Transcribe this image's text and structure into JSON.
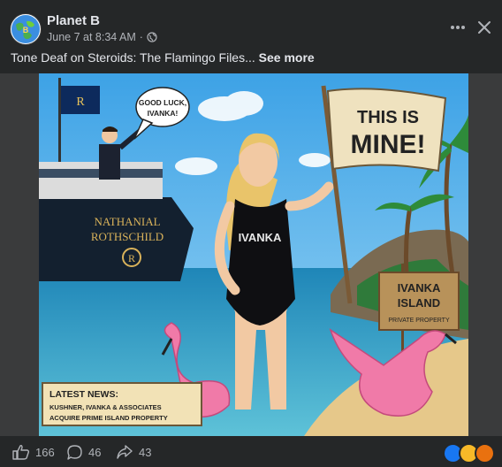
{
  "post": {
    "page_name": "Planet B",
    "timestamp": "June 7 at 8:34 AM",
    "separator": "·",
    "caption": "Tone Deaf on Steroids: The Flamingo Files...",
    "see_more": "See more"
  },
  "image": {
    "speech_bubble_line1": "GOOD LUCK,",
    "speech_bubble_line2": "IVANKA!",
    "flag_text": "R",
    "yacht_name_line1": "NATHANIAL",
    "yacht_name_line2": "ROTHSCHILD",
    "yacht_emblem": "R",
    "swimsuit_text": "IVANKA",
    "banner_line1": "THIS IS",
    "banner_line2": "MINE!",
    "sign_line1": "IVANKA",
    "sign_line2": "ISLAND",
    "sign_line3": "PRIVATE PROPERTY",
    "news_title": "LATEST NEWS:",
    "news_line1": "KUSHNER, IVANKA & ASSOCIATES",
    "news_line2": "ACQUIRE PRIME ISLAND PROPERTY"
  },
  "actions": {
    "likes": "166",
    "comments": "46",
    "shares": "43"
  },
  "reactions": [
    "like",
    "haha",
    "angry"
  ],
  "colors": {
    "background": "#252728",
    "text": "#e4e6eb",
    "muted": "#b0b3b8",
    "like_blue": "#1877f2",
    "haha_yellow": "#f7b928",
    "angry_red": "#e9710f"
  }
}
